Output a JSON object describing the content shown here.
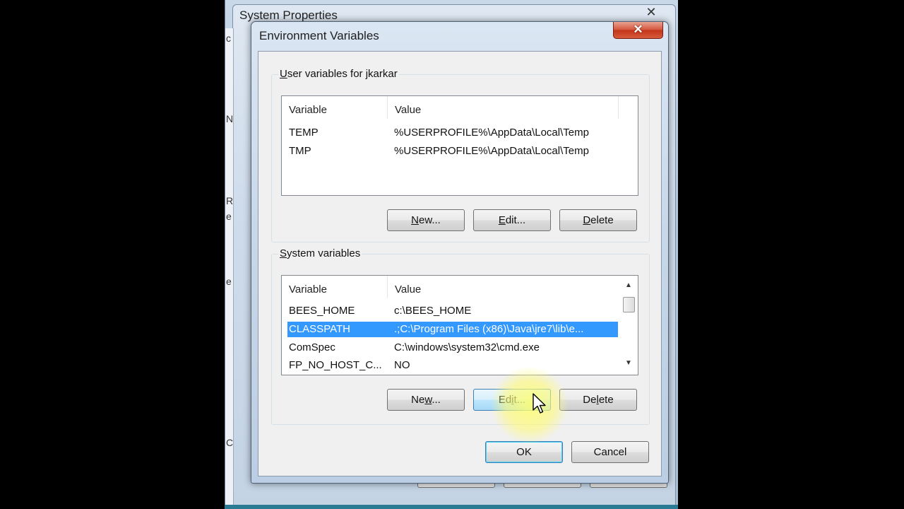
{
  "background_window": {
    "title": "System Properties",
    "close_label": "✕",
    "edge_chars": [
      "c",
      "N",
      "R",
      "e",
      "e",
      "C"
    ]
  },
  "dialog": {
    "title": "Environment Variables",
    "close_label": "✕",
    "user_group": {
      "label_prefix": "",
      "label_access_key": "U",
      "label_rest": "ser variables for jkarkar",
      "columns": [
        "Variable",
        "Value"
      ],
      "rows": [
        {
          "variable": "TEMP",
          "value": "%USERPROFILE%\\AppData\\Local\\Temp"
        },
        {
          "variable": "TMP",
          "value": "%USERPROFILE%\\AppData\\Local\\Temp"
        }
      ],
      "buttons": {
        "new_key": "N",
        "new_rest": "ew...",
        "edit_key": "E",
        "edit_rest": "dit...",
        "delete_key": "D",
        "delete_rest": "elete"
      }
    },
    "system_group": {
      "label_access_key": "S",
      "label_rest": "ystem variables",
      "columns": [
        "Variable",
        "Value"
      ],
      "rows": [
        {
          "variable": "BEES_HOME",
          "value": "c:\\BEES_HOME"
        },
        {
          "variable": "CLASSPATH",
          "value": ".;C:\\Program Files (x86)\\Java\\jre7\\lib\\e..."
        },
        {
          "variable": "ComSpec",
          "value": "C:\\windows\\system32\\cmd.exe"
        },
        {
          "variable": "FP_NO_HOST_C...",
          "value": "NO"
        }
      ],
      "selected_row": "CLASSPATH",
      "buttons": {
        "new_lead": "Ne",
        "new_key": "w",
        "new_rest": "...",
        "edit_lead": "Ed",
        "edit_key": "i",
        "edit_rest": "t...",
        "delete_lead": "De",
        "delete_key": "l",
        "delete_rest": "ete"
      }
    },
    "ok_label": "OK",
    "cancel_label": "Cancel"
  },
  "colors": {
    "selection": "#3399ff",
    "close_button": "#c3351b",
    "cursor_highlight": "#ffff6e"
  },
  "icons": {
    "scroll_up": "▲",
    "scroll_down": "▼"
  }
}
